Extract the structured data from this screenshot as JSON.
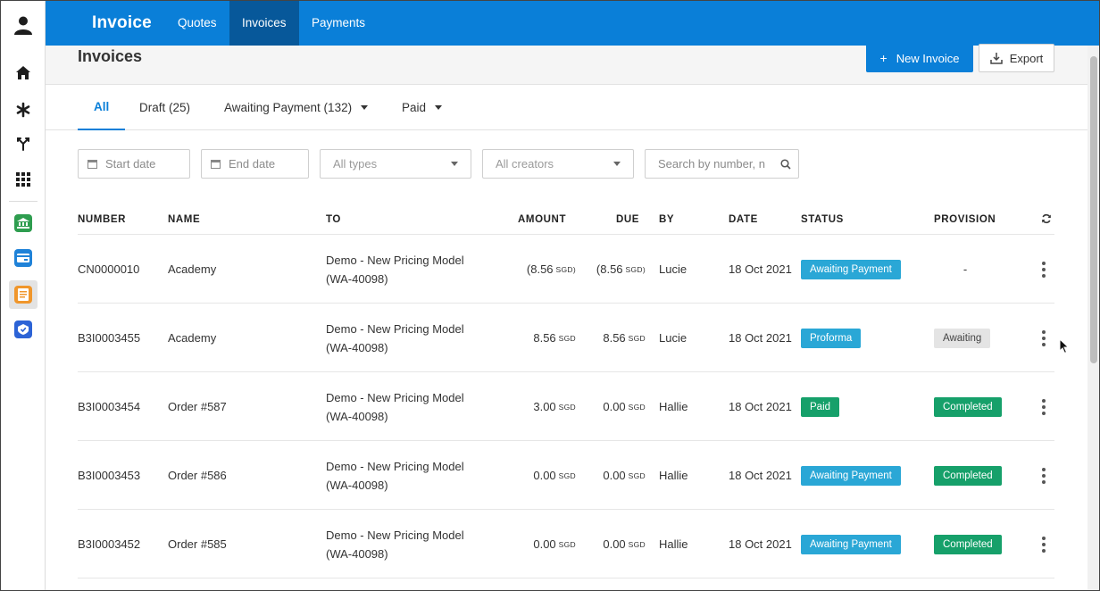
{
  "app": {
    "title": "Invoice"
  },
  "nav": {
    "tabs": [
      {
        "label": "Quotes"
      },
      {
        "label": "Invoices"
      },
      {
        "label": "Payments"
      }
    ]
  },
  "sidebar": {
    "items": [
      {
        "icon": "user-icon"
      },
      {
        "icon": "home-icon"
      },
      {
        "icon": "asterisk-icon"
      },
      {
        "icon": "merge-icon"
      },
      {
        "icon": "grid-icon"
      },
      {
        "icon": "bank-app-icon"
      },
      {
        "icon": "card-app-icon"
      },
      {
        "icon": "notes-app-icon"
      },
      {
        "icon": "badge-app-icon"
      }
    ]
  },
  "page": {
    "title": "Invoices",
    "new_button": "New Invoice",
    "export_button": "Export",
    "new_icon": "+"
  },
  "status_tabs": [
    {
      "label": "All"
    },
    {
      "label": "Draft (25)"
    },
    {
      "label": "Awaiting Payment (132)"
    },
    {
      "label": "Paid"
    }
  ],
  "filters": {
    "start_date": "Start date",
    "end_date": "End date",
    "types": "All types",
    "creators": "All creators",
    "search_placeholder": "Search by number, n"
  },
  "table": {
    "columns": {
      "number": "NUMBER",
      "name": "NAME",
      "to": "TO",
      "amount": "AMOUNT",
      "due": "DUE",
      "by": "BY",
      "date": "DATE",
      "status": "STATUS",
      "provision": "PROVISION"
    },
    "rows": [
      {
        "number": "CN0000010",
        "name": "Academy",
        "to_line1": "Demo - New Pricing Model",
        "to_line2": "(WA-40098)",
        "amount": "(8.56",
        "amount_cur": "SGD)",
        "due": "(8.56",
        "due_cur": "SGD)",
        "by": "Lucie",
        "date": "18 Oct 2021",
        "status": "Awaiting Payment",
        "provision": "-"
      },
      {
        "number": "B3I0003455",
        "name": "Academy",
        "to_line1": "Demo - New Pricing Model",
        "to_line2": "(WA-40098)",
        "amount": "8.56",
        "amount_cur": "SGD",
        "due": "8.56",
        "due_cur": "SGD",
        "by": "Lucie",
        "date": "18 Oct 2021",
        "status": "Proforma",
        "provision": "Awaiting"
      },
      {
        "number": "B3I0003454",
        "name": "Order #587",
        "to_line1": "Demo - New Pricing Model",
        "to_line2": "(WA-40098)",
        "amount": "3.00",
        "amount_cur": "SGD",
        "due": "0.00",
        "due_cur": "SGD",
        "by": "Hallie",
        "date": "18 Oct 2021",
        "status": "Paid",
        "provision": "Completed"
      },
      {
        "number": "B3I0003453",
        "name": "Order #586",
        "to_line1": "Demo - New Pricing Model",
        "to_line2": "(WA-40098)",
        "amount": "0.00",
        "amount_cur": "SGD",
        "due": "0.00",
        "due_cur": "SGD",
        "by": "Hallie",
        "date": "18 Oct 2021",
        "status": "Awaiting Payment",
        "provision": "Completed"
      },
      {
        "number": "B3I0003452",
        "name": "Order #585",
        "to_line1": "Demo - New Pricing Model",
        "to_line2": "(WA-40098)",
        "amount": "0.00",
        "amount_cur": "SGD",
        "due": "0.00",
        "due_cur": "SGD",
        "by": "Hallie",
        "date": "18 Oct 2021",
        "status": "Awaiting Payment",
        "provision": "Completed"
      }
    ]
  },
  "colors": {
    "primary": "#0a7fd8",
    "awaiting_payment": "#2aa7d6",
    "proforma": "#2aa7d6",
    "paid": "#16a06a",
    "completed": "#16a06a",
    "awaiting_provision_bg": "#e4e4e4"
  }
}
